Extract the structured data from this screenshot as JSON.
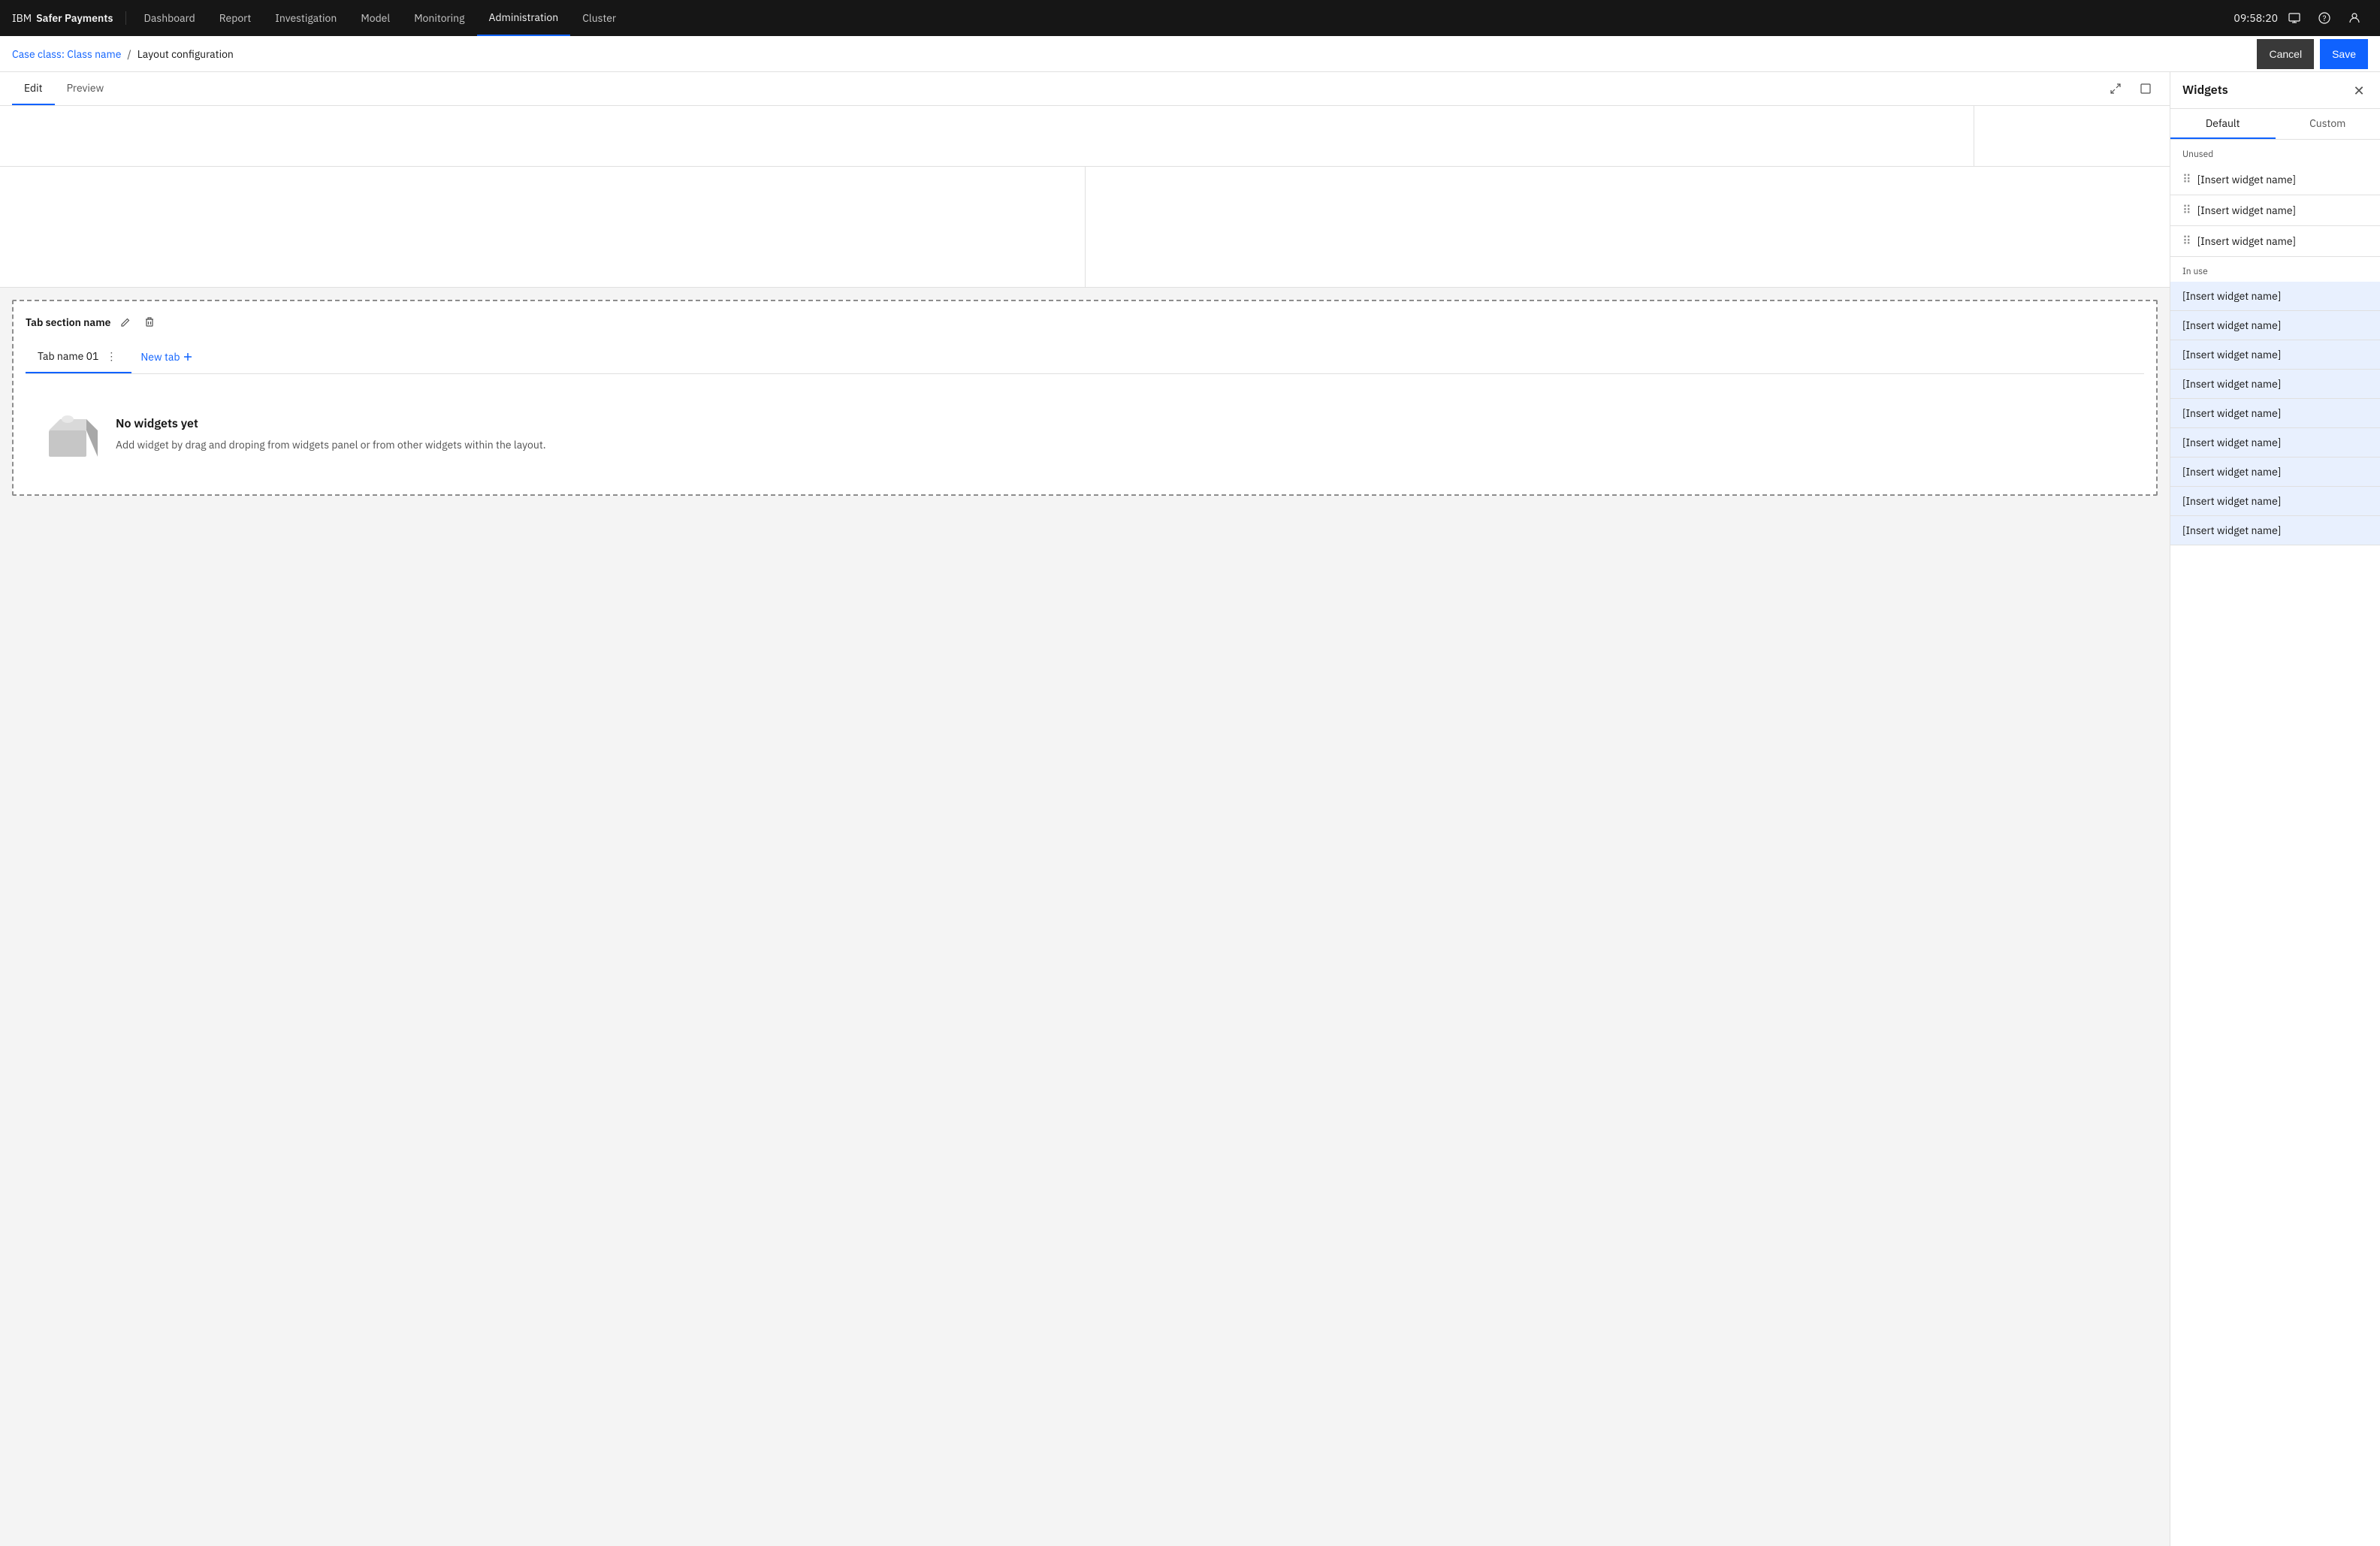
{
  "brand": {
    "ibm": "IBM",
    "product": "Safer Payments"
  },
  "nav": {
    "items": [
      {
        "id": "dashboard",
        "label": "Dashboard",
        "active": false
      },
      {
        "id": "report",
        "label": "Report",
        "active": false
      },
      {
        "id": "investigation",
        "label": "Investigation",
        "active": false
      },
      {
        "id": "model",
        "label": "Model",
        "active": false
      },
      {
        "id": "monitoring",
        "label": "Monitoring",
        "active": false
      },
      {
        "id": "administration",
        "label": "Administration",
        "active": true
      },
      {
        "id": "cluster",
        "label": "Cluster",
        "active": false
      }
    ],
    "time": "09:58:20"
  },
  "breadcrumb": {
    "link": "Case class: Class name",
    "separator": "/",
    "current": "Layout configuration"
  },
  "actions": {
    "cancel": "Cancel",
    "save": "Save"
  },
  "edit_tabs": {
    "tabs": [
      {
        "id": "edit",
        "label": "Edit",
        "active": true
      },
      {
        "id": "preview",
        "label": "Preview",
        "active": false
      }
    ]
  },
  "tab_section": {
    "name": "Tab section name",
    "tabs": [
      {
        "id": "tab01",
        "label": "Tab name 01",
        "active": true
      },
      {
        "id": "newtab",
        "label": "New tab",
        "active": false
      }
    ],
    "empty_state": {
      "title": "No widgets yet",
      "description": "Add widget by drag and droping from widgets panel or from other widgets within the layout."
    }
  },
  "widgets_panel": {
    "title": "Widgets",
    "tabs": [
      {
        "id": "default",
        "label": "Default",
        "active": true
      },
      {
        "id": "custom",
        "label": "Custom",
        "active": false
      }
    ],
    "unused_label": "Unused",
    "unused_items": [
      {
        "id": "u1",
        "label": "[Insert widget name]"
      },
      {
        "id": "u2",
        "label": "[Insert widget name]"
      },
      {
        "id": "u3",
        "label": "[Insert widget name]"
      }
    ],
    "inuse_label": "In use",
    "inuse_items": [
      {
        "id": "i1",
        "label": "[Insert widget name]"
      },
      {
        "id": "i2",
        "label": "[Insert widget name]"
      },
      {
        "id": "i3",
        "label": "[Insert widget name]"
      },
      {
        "id": "i4",
        "label": "[Insert widget name]"
      },
      {
        "id": "i5",
        "label": "[Insert widget name]"
      },
      {
        "id": "i6",
        "label": "[Insert widget name]"
      },
      {
        "id": "i7",
        "label": "[Insert widget name]"
      },
      {
        "id": "i8",
        "label": "[Insert widget name]"
      },
      {
        "id": "i9",
        "label": "[Insert widget name]"
      }
    ]
  }
}
